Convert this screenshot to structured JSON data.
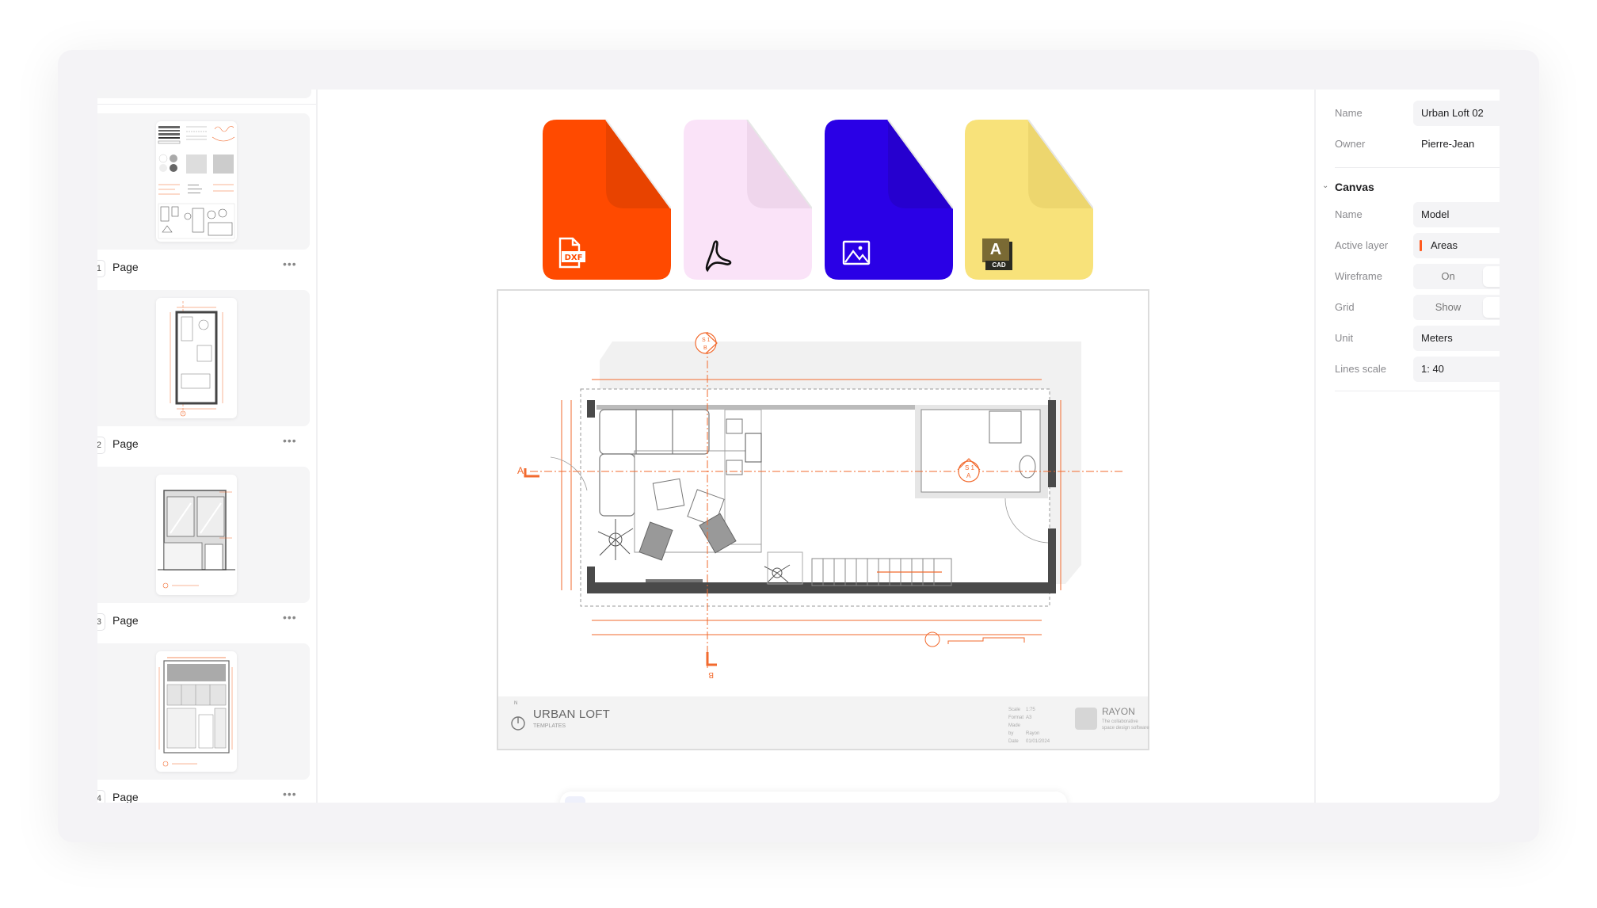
{
  "sidebar": {
    "pages": [
      {
        "number": "1",
        "label": "Page",
        "more": "•••",
        "thumbnail": "symbol-library"
      },
      {
        "number": "2",
        "label": "Page",
        "more": "•••",
        "thumbnail": "floor-plan"
      },
      {
        "number": "3",
        "label": "Page",
        "more": "•••",
        "thumbnail": "facade-elevation"
      },
      {
        "number": "4",
        "label": "Page",
        "more": "•••",
        "thumbnail": "section-view"
      }
    ]
  },
  "canvas": {
    "export_formats": [
      {
        "name": "DXF",
        "icon": "dxf-file-icon",
        "color": "#FF4A00",
        "fold_color": "#E64200"
      },
      {
        "name": "PDF",
        "icon": "acrobat-pdf-icon",
        "color": "#FAE3F8",
        "fold_color": "#EFD6EC"
      },
      {
        "name": "Image",
        "icon": "image-icon",
        "color": "#2A00E6",
        "fold_color": "#2600CF"
      },
      {
        "name": "AutoCAD",
        "icon": "autocad-icon",
        "color": "#F8E27A",
        "fold_color": "#EDD66E",
        "badge_letter": "A",
        "badge_text": "CAD"
      }
    ],
    "drawing": {
      "section_markers": {
        "top": {
          "sheet": "S 1",
          "ref": "B"
        },
        "right": {
          "sheet": "S 1",
          "ref": "A"
        },
        "left_label": "A",
        "bottom_label": "B"
      },
      "accent_color": "#F26A2E",
      "title_block": {
        "title": "URBAN LOFT",
        "subtitle": "TEMPLATES",
        "north_label": "N",
        "meta": [
          {
            "key": "Scale",
            "value": "1:75"
          },
          {
            "key": "Format",
            "value": "A3"
          },
          {
            "key": "Made by",
            "value": "Rayon"
          },
          {
            "key": "Date",
            "value": "01/01/2024"
          }
        ],
        "brand": "RAYON",
        "tagline": "The collaborative space design software"
      }
    }
  },
  "properties": {
    "model": {
      "rows": [
        {
          "label": "Name",
          "value": "Urban Loft 02"
        },
        {
          "label": "Owner",
          "value": "Pierre-Jean"
        }
      ]
    },
    "canvas_section": {
      "title": "Canvas",
      "name": {
        "label": "Name",
        "value": "Model"
      },
      "active_layer": {
        "label": "Active layer",
        "value": "Areas",
        "color": "#FF5A1F"
      },
      "wireframe": {
        "label": "Wireframe",
        "value": "On"
      },
      "grid": {
        "label": "Grid",
        "value": "Show"
      },
      "unit": {
        "label": "Unit",
        "value": "Meters"
      },
      "lines_scale": {
        "label": "Lines scale",
        "value": "1: 40"
      }
    }
  }
}
